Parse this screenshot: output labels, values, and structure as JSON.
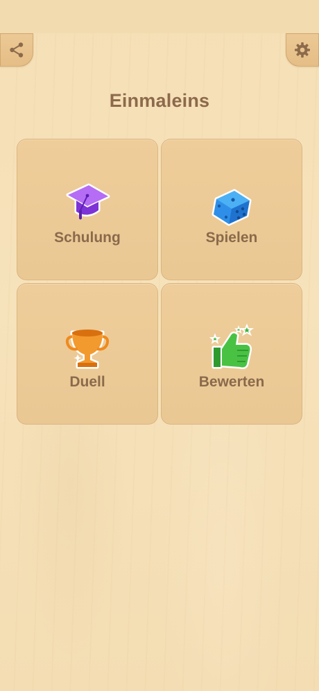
{
  "app": {
    "title": "Einmaleins"
  },
  "toolbar": {
    "share_icon": "share-icon",
    "settings_icon": "gear-icon"
  },
  "menu": {
    "items": [
      {
        "label": "Schulung",
        "icon": "graduation-cap-icon",
        "color": "#8a3fe0"
      },
      {
        "label": "Spielen",
        "icon": "dice-icon",
        "color": "#2f8fe8"
      },
      {
        "label": "Duell",
        "icon": "trophy-icon",
        "color": "#f08a1c"
      },
      {
        "label": "Bewerten",
        "icon": "thumbs-up-icon",
        "color": "#3fb53a"
      }
    ]
  },
  "colors": {
    "background": "#f5dfb6",
    "tile": "#eecd9a",
    "text": "#8c6a4b"
  }
}
